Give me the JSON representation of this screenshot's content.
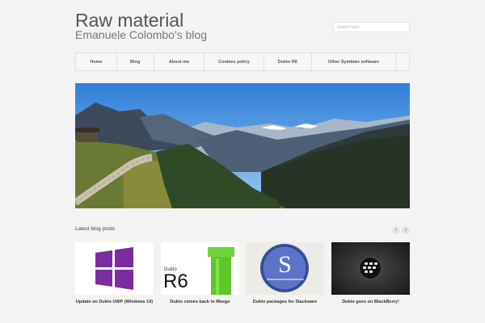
{
  "header": {
    "site_title": "Raw material",
    "tagline": "Emanuele Colombo's blog"
  },
  "search": {
    "placeholder": "Search here"
  },
  "nav": {
    "items": [
      {
        "label": "Home"
      },
      {
        "label": "Blog"
      },
      {
        "label": "About me"
      },
      {
        "label": "Cookies policy"
      },
      {
        "label": "Dukto R6"
      },
      {
        "label": "Other Symbian software"
      }
    ]
  },
  "hero": {
    "image": "mountain-valley-landscape"
  },
  "latest": {
    "heading": "Latest blog posts",
    "prev_icon": "‹",
    "next_icon": "›",
    "posts": [
      {
        "title": "Update on Dukto UWP (Windows 10)",
        "thumb": "windows-logo"
      },
      {
        "title": "Dukto comes back to Meego",
        "thumb": "dukto-r6-logo",
        "thumb_text_small": "Dukto",
        "thumb_text_large": "R6"
      },
      {
        "title": "Dukto packages for Slackware",
        "thumb": "slackware-logo",
        "thumb_text": "S"
      },
      {
        "title": "Dukto goes on BlackBerry!",
        "thumb": "blackberry-logo"
      }
    ]
  },
  "colors": {
    "background": "#f3f3f3",
    "windows_purple": "#7b2da0",
    "dukto_green": "#5ec52a",
    "slackware_blue": "#3b4fa0",
    "blackberry_dark": "#2a2a2a"
  }
}
